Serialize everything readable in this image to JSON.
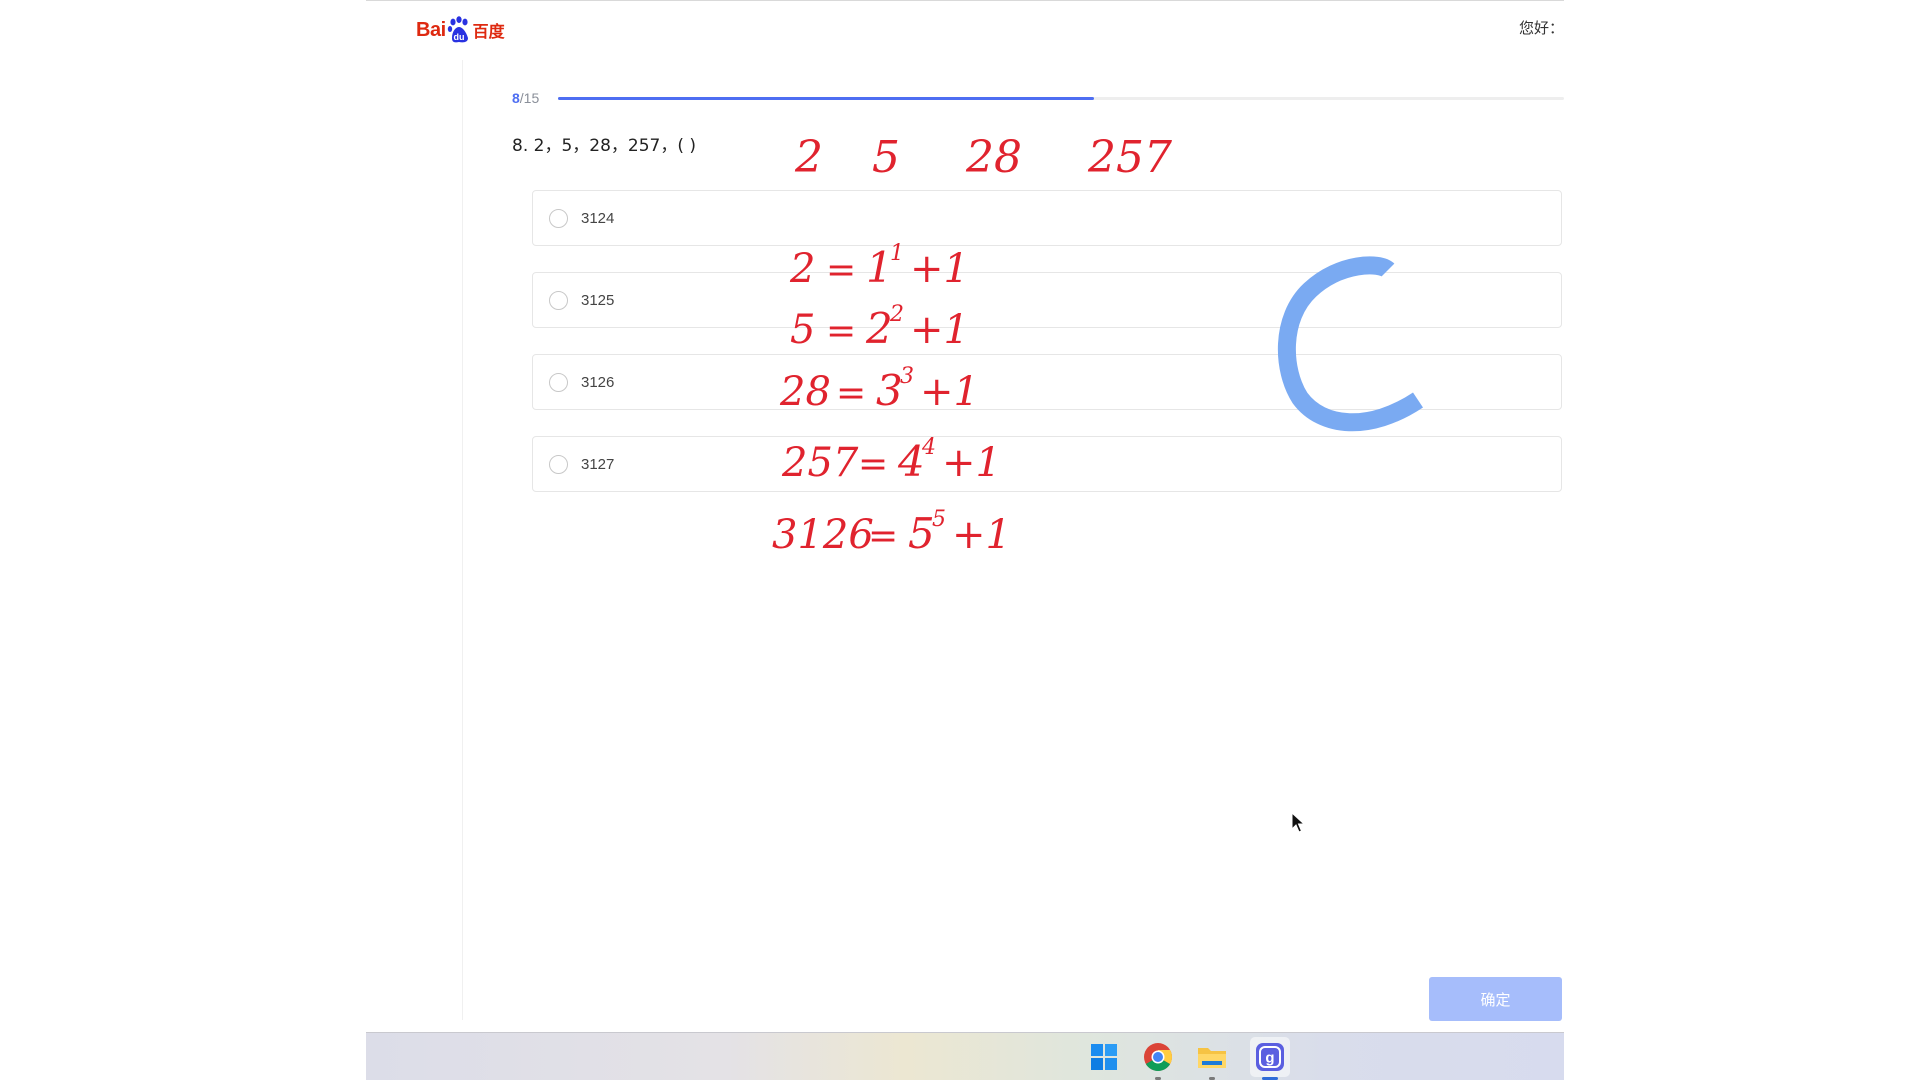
{
  "header": {
    "logo_bai": "Bai",
    "logo_du": "du",
    "logo_cn": "百度",
    "greeting": "您好："
  },
  "progress": {
    "current": "8",
    "total": "/15",
    "fraction": 0.533
  },
  "question": {
    "text": "8. 2，5，28，257，( )"
  },
  "options": [
    {
      "label": "3124"
    },
    {
      "label": "3125"
    },
    {
      "label": "3126"
    },
    {
      "label": "3127"
    }
  ],
  "confirm_label": "确定",
  "annotation": {
    "sequence": [
      "2",
      "5",
      "28",
      "257"
    ],
    "equations": [
      {
        "lhs": "2",
        "base": "1",
        "exp": "1",
        "plus": "+1"
      },
      {
        "lhs": "5",
        "base": "2",
        "exp": "2",
        "plus": "+1"
      },
      {
        "lhs": "28",
        "base": "3",
        "exp": "3",
        "plus": "+1"
      },
      {
        "lhs": "257",
        "base": "4",
        "exp": "4",
        "plus": "+1"
      },
      {
        "lhs": "3126",
        "base": "5",
        "exp": "5",
        "plus": "+1"
      }
    ],
    "answer_mark": "C",
    "ink_color": "#e0232e",
    "answer_color": "#7aaaf2"
  },
  "taskbar": {
    "icons": [
      "windows-start-icon",
      "chrome-icon",
      "file-explorer-icon",
      "app-g-icon"
    ]
  }
}
